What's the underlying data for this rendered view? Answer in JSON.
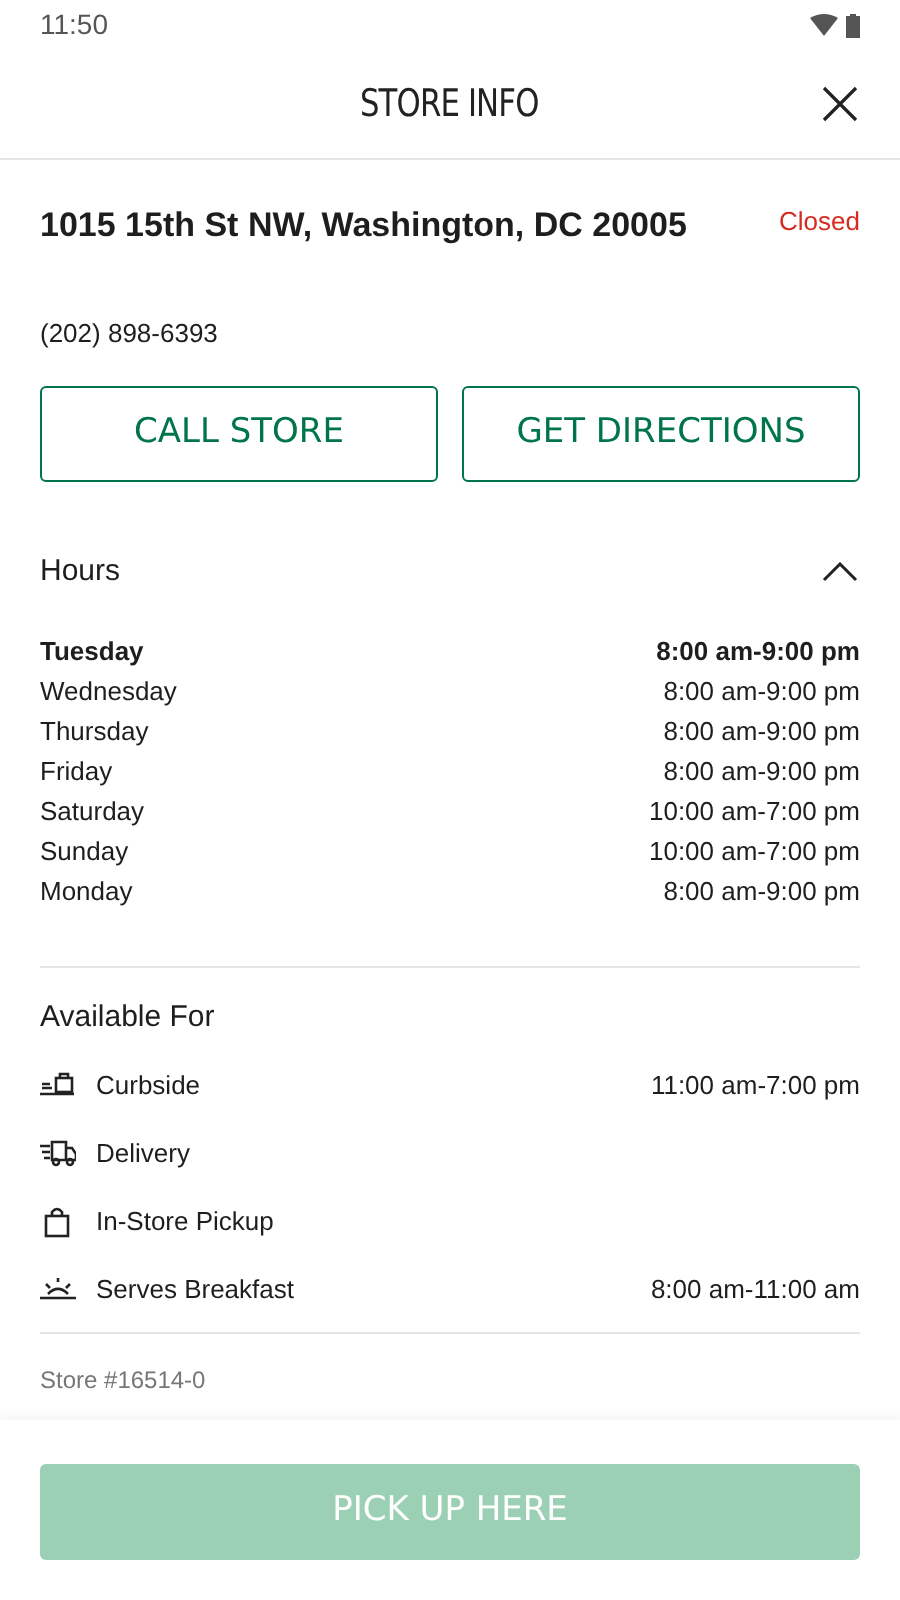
{
  "status_bar": {
    "time": "11:50"
  },
  "header": {
    "title": "STORE INFO"
  },
  "store": {
    "address": "1015 15th St NW, Washington, DC 20005",
    "status": "Closed",
    "phone": "(202) 898-6393"
  },
  "actions": [
    "CALL STORE",
    "GET DIRECTIONS"
  ],
  "hours": {
    "title": "Hours",
    "expanded": true,
    "days": [
      {
        "day": "Tuesday",
        "time": "8:00 am-9:00 pm",
        "current": true
      },
      {
        "day": "Wednesday",
        "time": "8:00 am-9:00 pm",
        "current": false
      },
      {
        "day": "Thursday",
        "time": "8:00 am-9:00 pm",
        "current": false
      },
      {
        "day": "Friday",
        "time": "8:00 am-9:00 pm",
        "current": false
      },
      {
        "day": "Saturday",
        "time": "10:00 am-7:00 pm",
        "current": false
      },
      {
        "day": "Sunday",
        "time": "10:00 am-7:00 pm",
        "current": false
      },
      {
        "day": "Monday",
        "time": "8:00 am-9:00 pm",
        "current": false
      }
    ]
  },
  "available": {
    "title": "Available For",
    "services": [
      {
        "kind": "curbside",
        "label": "Curbside",
        "time": "11:00 am-7:00 pm"
      },
      {
        "kind": "delivery",
        "label": "Delivery"
      },
      {
        "kind": "pickup",
        "label": "In-Store Pickup"
      },
      {
        "kind": "breakfast",
        "label": "Serves Breakfast",
        "time": "8:00 am-11:00 am"
      }
    ]
  },
  "store_number": "Store #16514-0",
  "pickup_button": {
    "label": "PICK UP HERE",
    "disabled": true
  }
}
